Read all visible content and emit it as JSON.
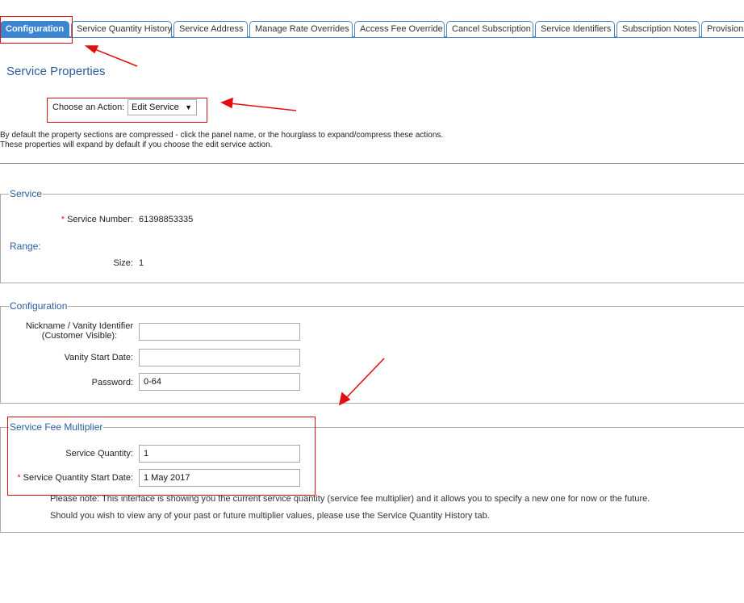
{
  "tabs": [
    {
      "label": "Configuration",
      "active": true
    },
    {
      "label": "Service Quantity History"
    },
    {
      "label": "Service Address"
    },
    {
      "label": "Manage Rate Overrides"
    },
    {
      "label": "Access Fee Override"
    },
    {
      "label": "Cancel Subscription"
    },
    {
      "label": "Service Identifiers"
    },
    {
      "label": "Subscription Notes"
    },
    {
      "label": "Provisioni"
    }
  ],
  "page_title": "Service Properties",
  "action": {
    "label": "Choose an Action:",
    "selected": "Edit Service"
  },
  "help": {
    "line1": "By default the property sections are compressed - click the panel name, or the hourglass to expand/compress these actions.",
    "line2": "These properties will expand by default if you choose the edit service action."
  },
  "service": {
    "legend": "Service",
    "number_label": "Service Number:",
    "number_value": "61398853335",
    "range_label": "Range:",
    "size_label": "Size:",
    "size_value": "1"
  },
  "configuration": {
    "legend": "Configuration",
    "nickname_label_1": "Nickname / Vanity Identifier",
    "nickname_label_2": "(Customer Visible):",
    "nickname_value": "",
    "vanity_date_label": "Vanity Start Date:",
    "vanity_date_value": "",
    "password_label": "Password:",
    "password_value": "0-64"
  },
  "fee": {
    "legend": "Service Fee Multiplier",
    "quantity_label": "Service Quantity:",
    "quantity_value": "1",
    "start_label": "Service Quantity Start Date:",
    "start_value": "1 May 2017",
    "note1": "Please note: This interface is showing you the current service quantity (service fee multiplier) and it allows you to specify a new one for now or the future.",
    "note2": "Should you wish to view any of your past or future multiplier values, please use the Service Quantity History tab."
  },
  "required_mark": "*",
  "caret_icon": "▼",
  "colors": {
    "accent": "#3b86d2",
    "legend": "#2a5d9f",
    "annotation": "#e01010"
  }
}
